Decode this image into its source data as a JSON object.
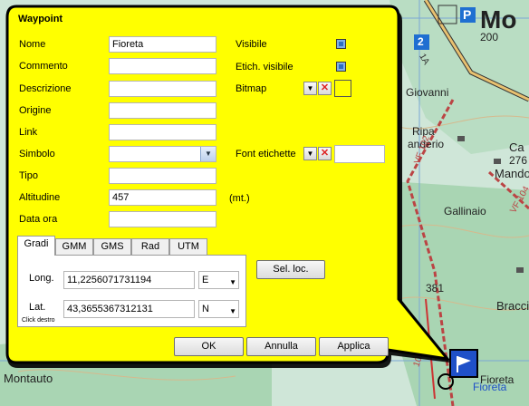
{
  "window": {
    "title": "Waypoint"
  },
  "fields": {
    "nome": {
      "label": "Nome",
      "value": "Fioreta"
    },
    "commento": {
      "label": "Commento",
      "value": ""
    },
    "descrizione": {
      "label": "Descrizione",
      "value": ""
    },
    "origine": {
      "label": "Origine",
      "value": ""
    },
    "link": {
      "label": "Link",
      "value": ""
    },
    "simbolo": {
      "label": "Simbolo",
      "value": ""
    },
    "tipo": {
      "label": "Tipo",
      "value": ""
    },
    "altitudine": {
      "label": "Altitudine",
      "value": "457",
      "unit": "(mt.)"
    },
    "data_ora": {
      "label": "Data ora",
      "value": ""
    }
  },
  "right_options": {
    "visibile": {
      "label": "Visibile",
      "checked": true
    },
    "etich_visibile": {
      "label": "Etich. visibile",
      "checked": true
    },
    "bitmap": {
      "label": "Bitmap"
    },
    "font_etichette": {
      "label": "Font etichette"
    }
  },
  "tabs": [
    {
      "label": "Gradi",
      "active": true
    },
    {
      "label": "GMM",
      "active": false
    },
    {
      "label": "GMS",
      "active": false
    },
    {
      "label": "Rad",
      "active": false
    },
    {
      "label": "UTM",
      "active": false
    }
  ],
  "coords": {
    "long": {
      "label": "Long.",
      "value": "11,2256071731194",
      "hemi": "E"
    },
    "lat": {
      "label": "Lat.",
      "value": "43,3655367312131",
      "hemi": "N"
    },
    "hint": "Click destro",
    "sel_loc": "Sel. loc."
  },
  "buttons": {
    "ok": "OK",
    "annulla": "Annulla",
    "applica": "Applica"
  },
  "map": {
    "labels": {
      "mo": "Mo",
      "n200": "200",
      "road2": "2",
      "giovanni": "Giovanni",
      "ripa": "Ripa",
      "landerio": "anderio",
      "ca": "Ca",
      "n276": "276",
      "mando": "Mando",
      "gallinaio": "Gallinaio",
      "n381": "381",
      "bracci": "Bracci",
      "montauto": "Montauto",
      "fioreta_map": "Fioreta",
      "fioreta_blue": "Fioreta",
      "road_vf": "VF 102",
      "road_vf2": "VF 104",
      "road_1a": "1A",
      "road_105b": "105B"
    },
    "colors": {
      "water": "#7aa6d6",
      "land": "#c9e5d5",
      "forest": "#9fcfa9",
      "road": "#e8c170",
      "callout": "#ffff00"
    }
  }
}
